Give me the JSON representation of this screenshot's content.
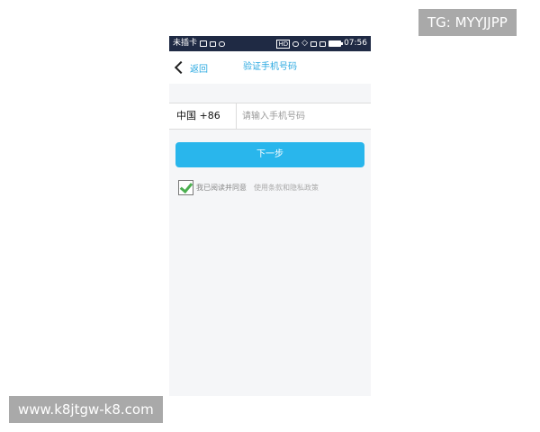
{
  "watermarks": {
    "top": "TG: MYYJJPP",
    "bottom": "www.k8jtgw-k8.com"
  },
  "status_bar": {
    "carrier": "未插卡",
    "network_badge": "HD",
    "time": "07:56"
  },
  "nav": {
    "back_label": "返回",
    "title": "验证手机号码"
  },
  "phone_form": {
    "country_code": "中国 +86",
    "phone_placeholder": "请输入手机号码",
    "phone_value": ""
  },
  "next_button": {
    "label": "下一步"
  },
  "agreement": {
    "checked": true,
    "text": "我已阅读并同意",
    "policy_link": "使用条款和隐私政策"
  },
  "colors": {
    "accent": "#29b6ec",
    "status_bar": "#1f2a44",
    "check": "#4caf50"
  }
}
